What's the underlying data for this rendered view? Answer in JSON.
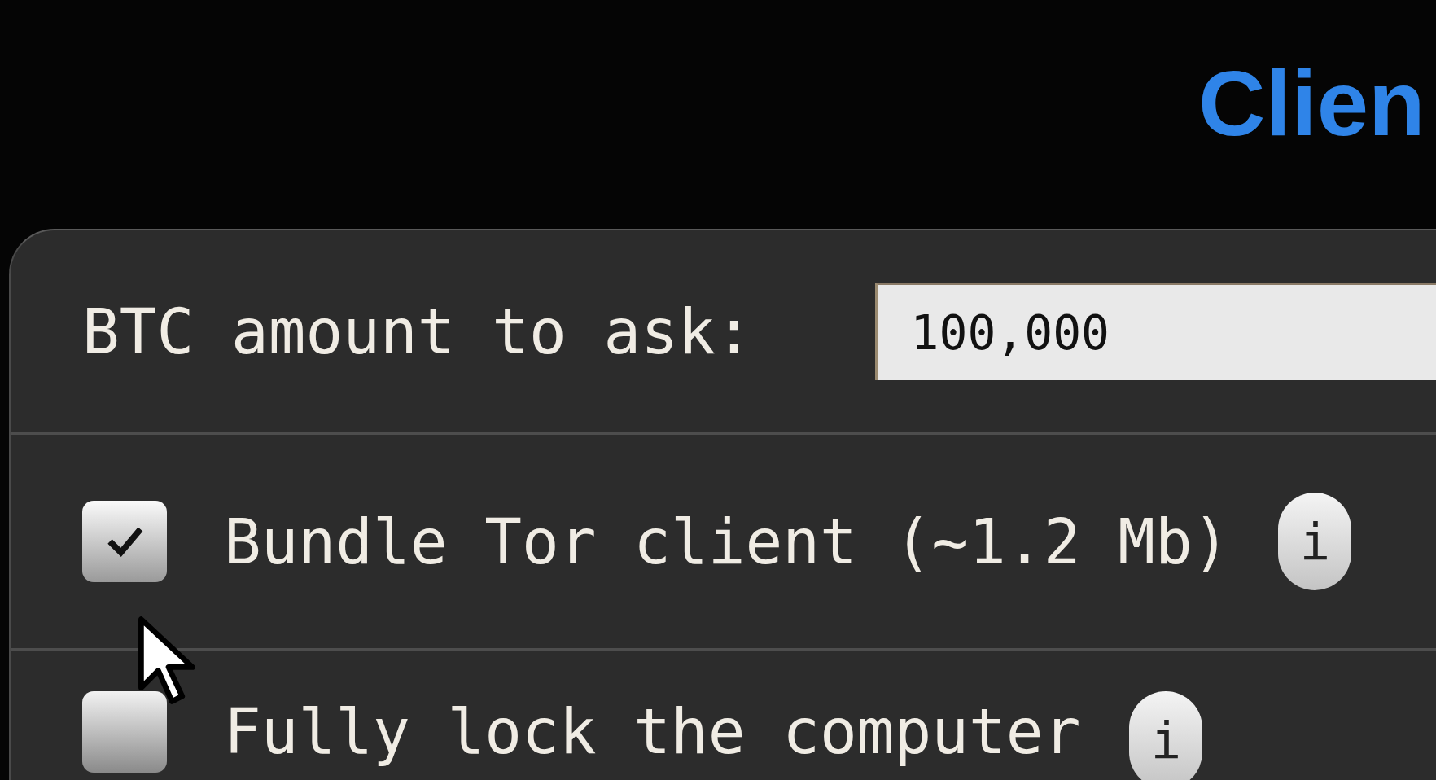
{
  "header": {
    "title": "Clien"
  },
  "amount": {
    "label": "BTC amount to ask:",
    "value": "100,000"
  },
  "options": [
    {
      "label": "Bundle Tor client (~1.2 Mb)",
      "checked": true,
      "info": "i"
    },
    {
      "label": "Fully lock the computer",
      "checked": false,
      "info": "i"
    }
  ]
}
